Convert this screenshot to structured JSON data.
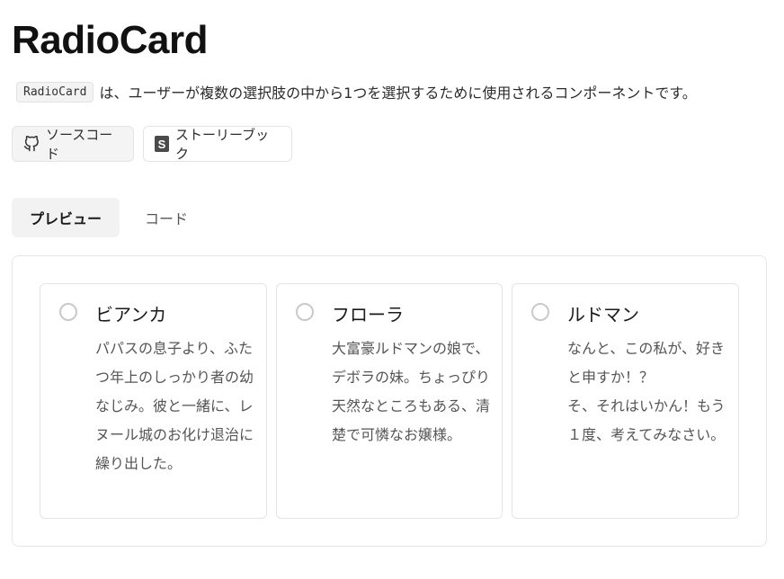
{
  "header": {
    "title": "RadioCard",
    "code_chip": "RadioCard",
    "description": "は、ユーザーが複数の選択肢の中から1つを選択するために使用されるコンポーネントです。"
  },
  "links": {
    "source_label": "ソースコード",
    "source_icon": "github-icon",
    "storybook_label": "ストーリーブック",
    "storybook_icon": "storybook-icon"
  },
  "tabs": [
    {
      "label": "プレビュー",
      "active": true
    },
    {
      "label": "コード",
      "active": false
    }
  ],
  "cards": [
    {
      "title": "ビアンカ",
      "description": "パパスの息子より、ふたつ年上のしっかり者の幼なじみ。彼と一緒に、レヌール城のお化け退治に繰り出した。",
      "selected": false
    },
    {
      "title": "フローラ",
      "description": "大富豪ルドマンの娘で、デボラの妹。ちょっぴり天然なところもある、清楚で可憐なお嬢様。",
      "selected": false
    },
    {
      "title": "ルドマン",
      "description": "なんと、この私が、好きと申すか！？\nそ、それはいかん！もう１度、考えてみなさい。",
      "selected": false
    }
  ],
  "colors": {
    "border": "#e4e4e4",
    "active_tab_bg": "#f2f2f2",
    "radio_border": "#c9c9c9"
  }
}
